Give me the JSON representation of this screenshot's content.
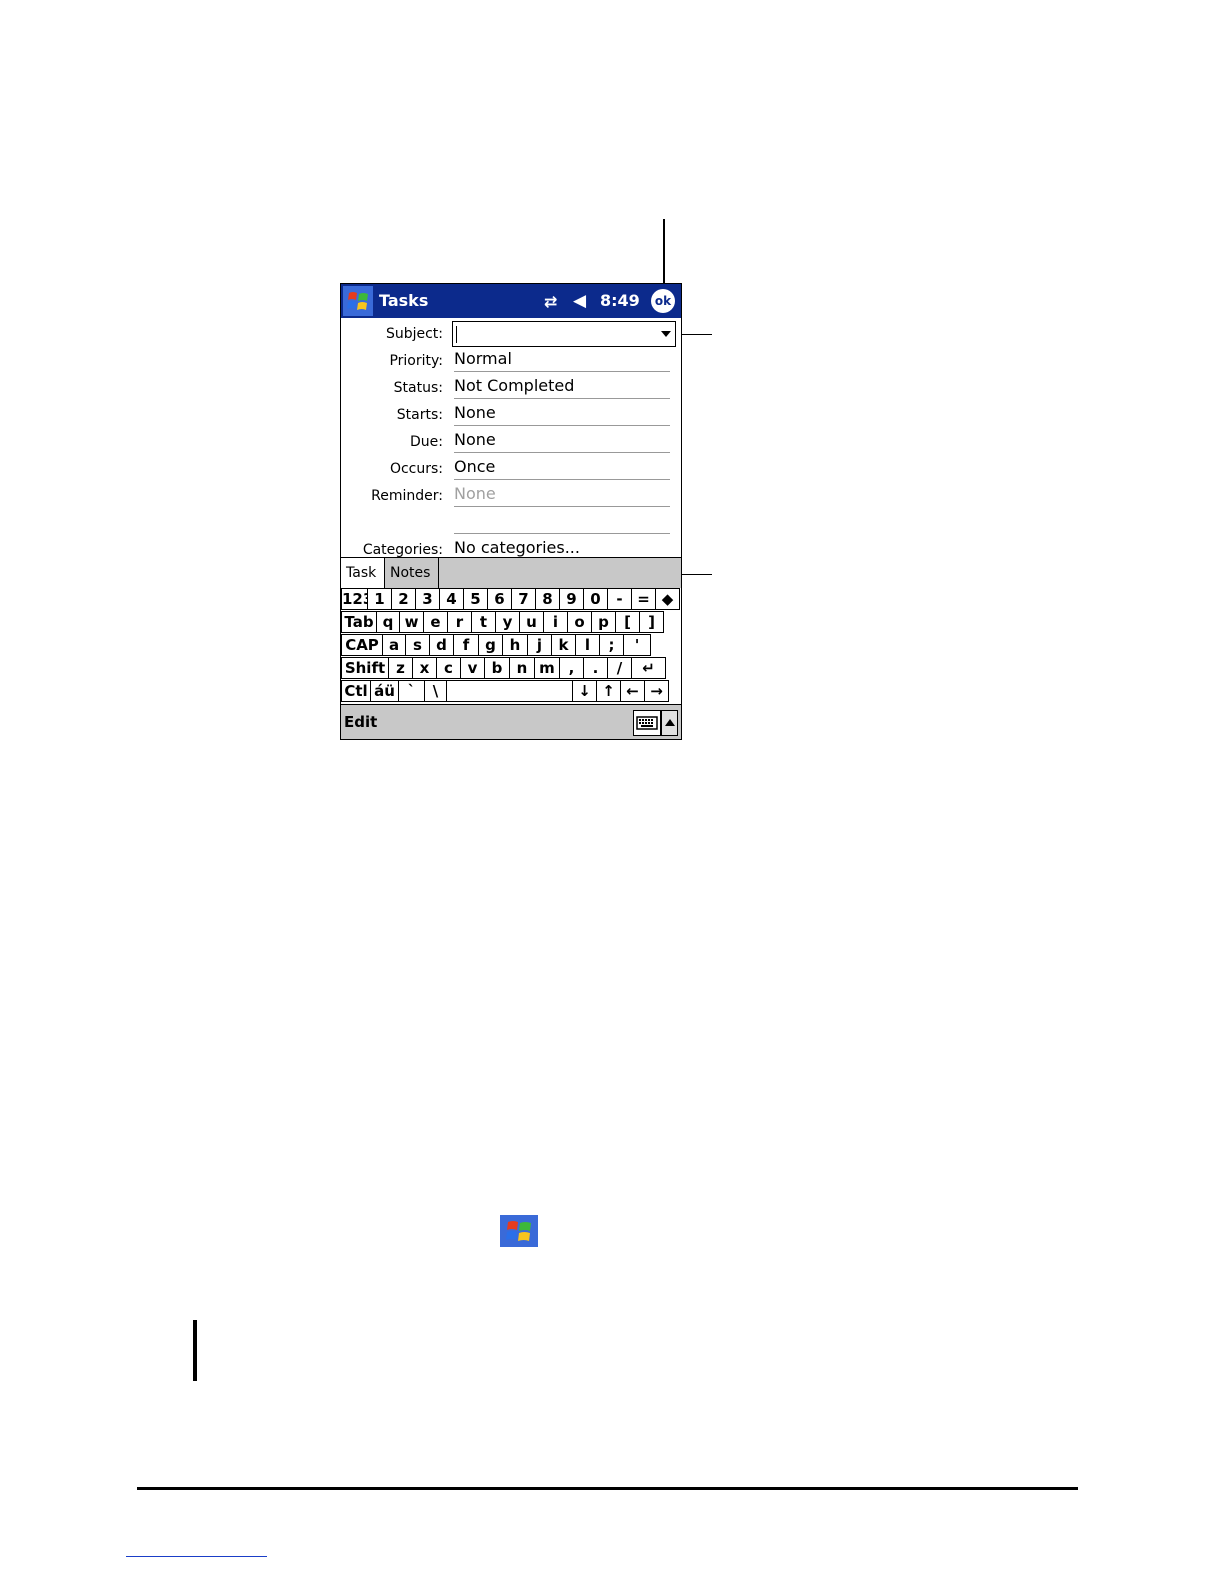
{
  "device": {
    "title": "Tasks",
    "time": "8:49",
    "ok_label": "ok",
    "connectivity_icon": "connectivity-icon",
    "speaker_icon": "speaker-muted-icon"
  },
  "form": {
    "fields": [
      {
        "label": "Subject:",
        "value": ""
      },
      {
        "label": "Priority:",
        "value": "Normal"
      },
      {
        "label": "Status:",
        "value": "Not Completed"
      },
      {
        "label": "Starts:",
        "value": "None"
      },
      {
        "label": "Due:",
        "value": "None"
      },
      {
        "label": "Occurs:",
        "value": "Once"
      },
      {
        "label": "Reminder:",
        "value": "None"
      },
      {
        "label": "Categories:",
        "value": "No categories..."
      }
    ]
  },
  "tabs": {
    "task": "Task",
    "notes": "Notes"
  },
  "keyboard": {
    "rows": [
      [
        "123",
        "1",
        "2",
        "3",
        "4",
        "5",
        "6",
        "7",
        "8",
        "9",
        "0",
        "-",
        "=",
        "◆"
      ],
      [
        "Tab",
        "q",
        "w",
        "e",
        "r",
        "t",
        "y",
        "u",
        "i",
        "o",
        "p",
        "[",
        "]"
      ],
      [
        "CAP",
        "a",
        "s",
        "d",
        "f",
        "g",
        "h",
        "j",
        "k",
        "l",
        ";",
        "'"
      ],
      [
        "Shift",
        "z",
        "x",
        "c",
        "v",
        "b",
        "n",
        "m",
        ",",
        ".",
        "/",
        "↵"
      ],
      [
        "Ctl",
        "áü",
        "`",
        "\\",
        " ",
        "↓",
        "↑",
        "←",
        "→"
      ]
    ]
  },
  "menubar": {
    "edit_label": "Edit"
  },
  "colors": {
    "titlebar": "#0c2a8c",
    "tab_bar": "#c8c8c8"
  }
}
